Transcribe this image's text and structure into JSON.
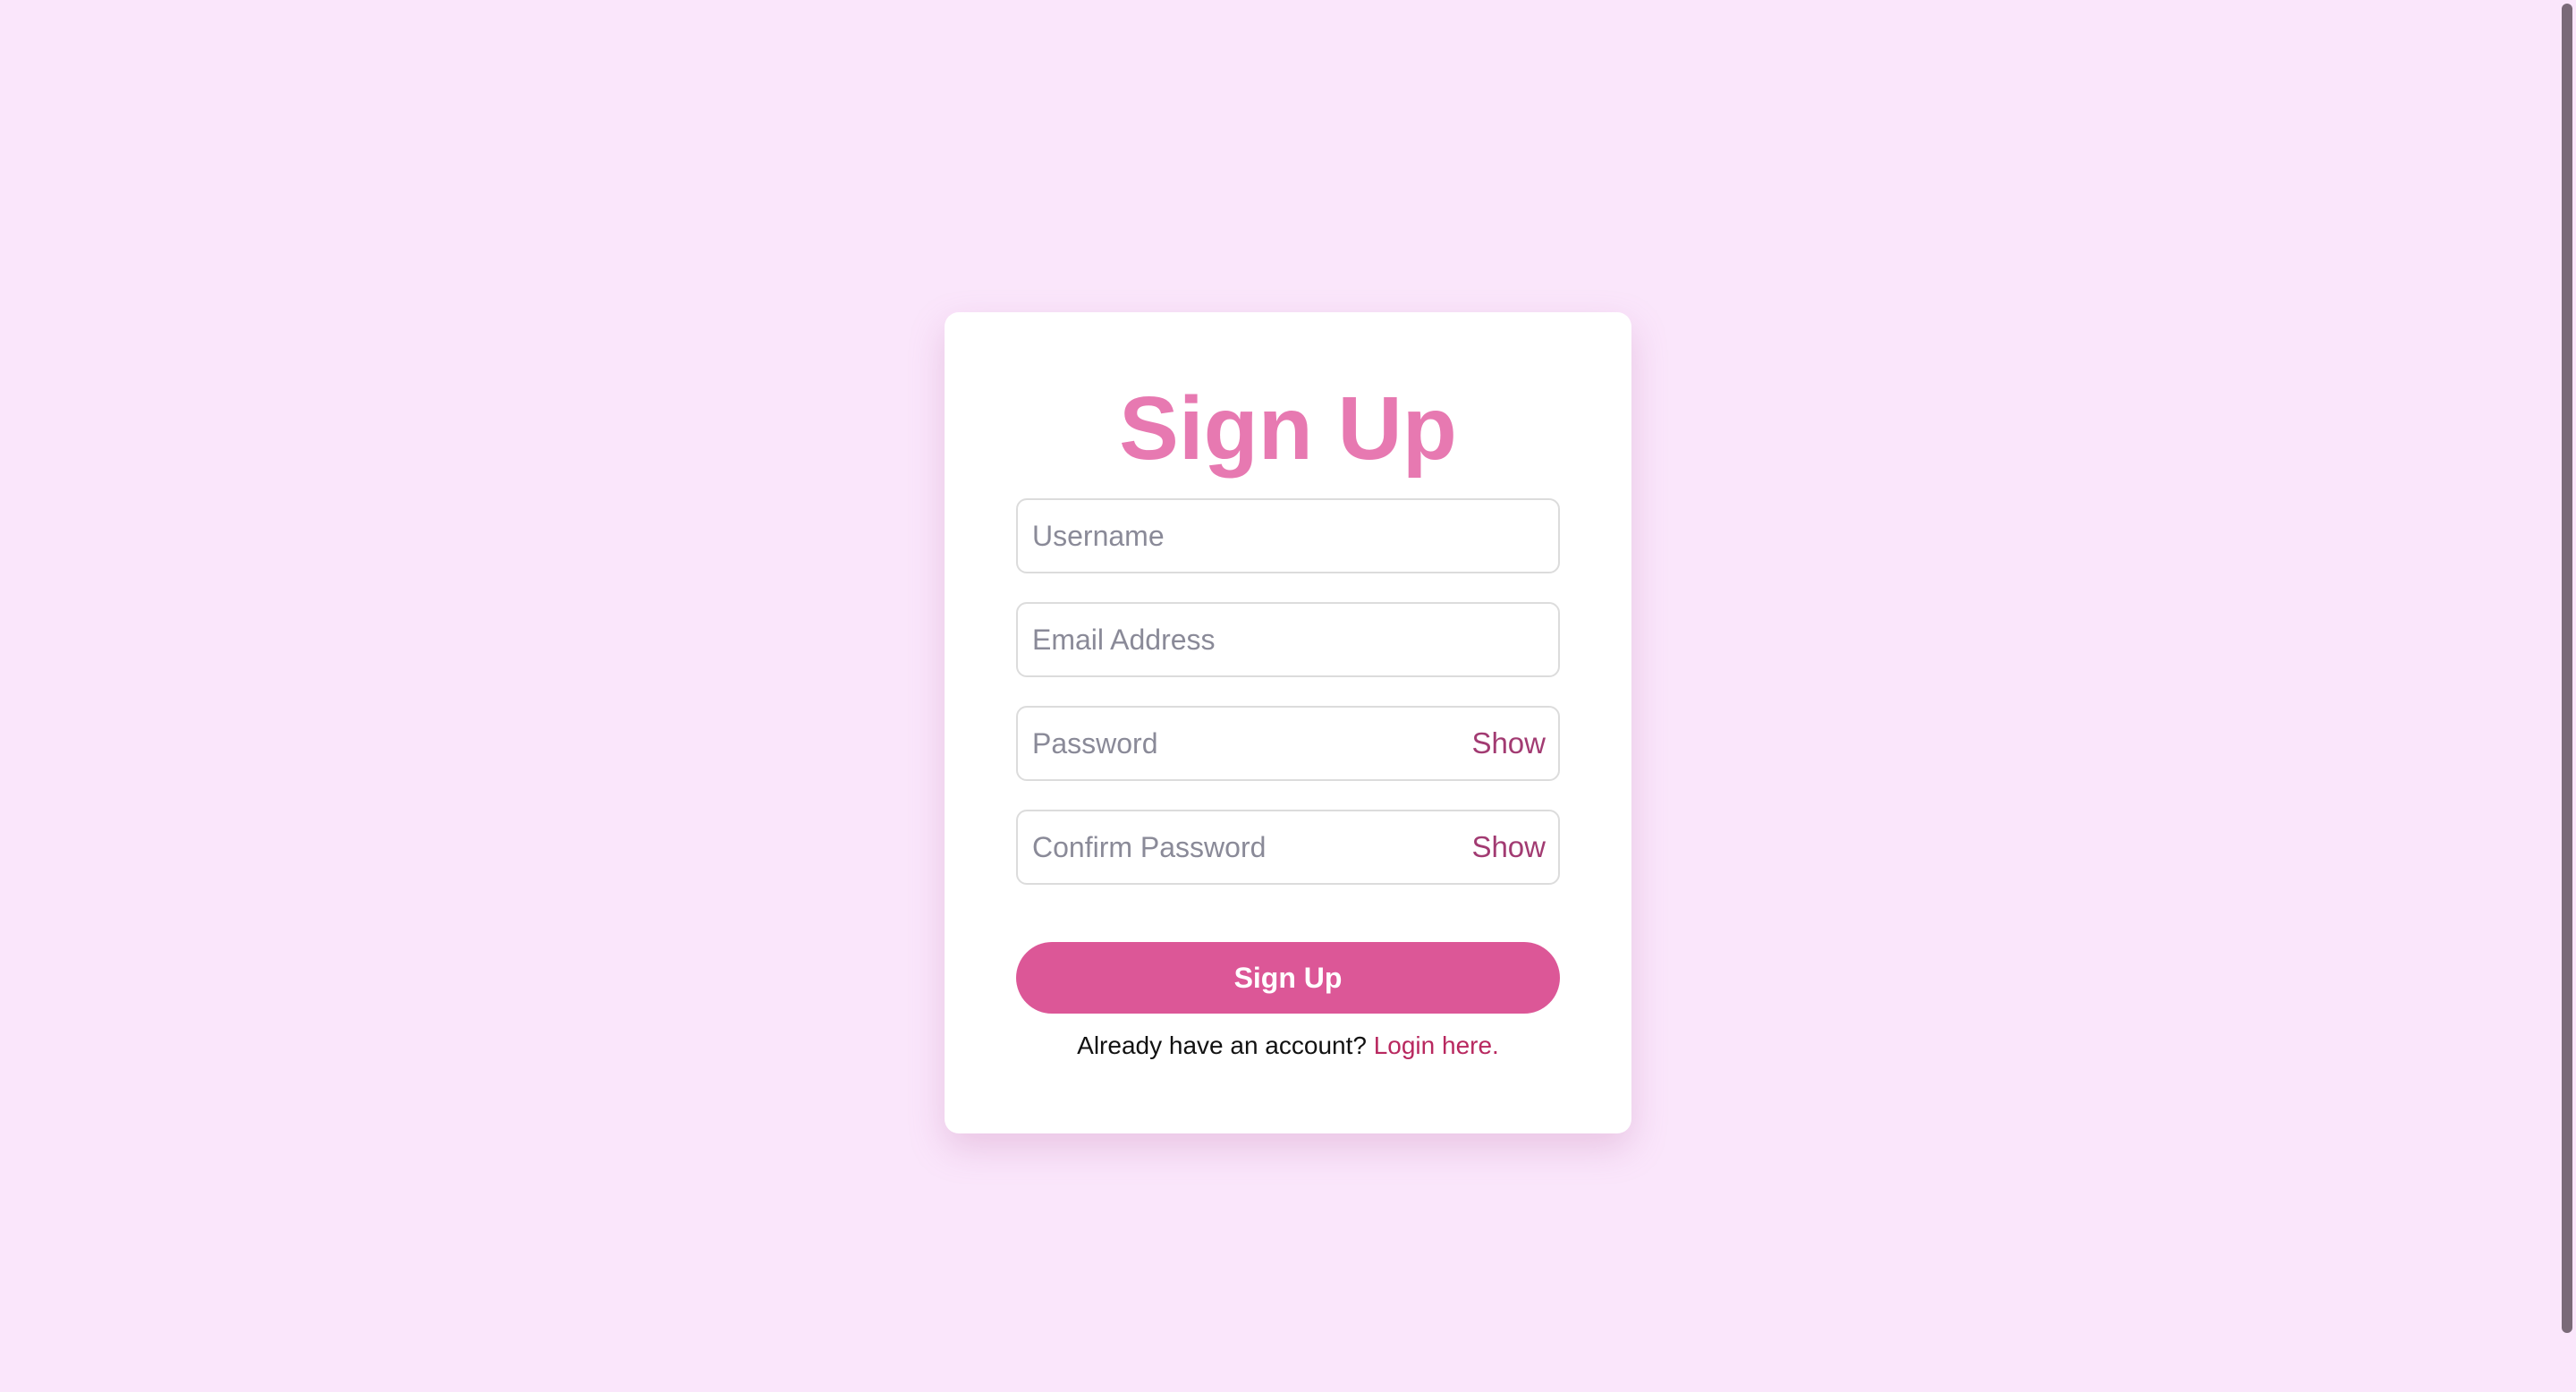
{
  "colors": {
    "background": "#fae6fb",
    "card": "#ffffff",
    "title": "#e779b1",
    "button": "#dc5797",
    "toggle": "#a23b72",
    "link": "#b8285f"
  },
  "form": {
    "title": "Sign Up",
    "fields": [
      {
        "placeholder": "Username",
        "value": ""
      },
      {
        "placeholder": "Email Address",
        "value": ""
      },
      {
        "placeholder": "Password",
        "value": "",
        "toggle_label": "Show"
      },
      {
        "placeholder": "Confirm Password",
        "value": "",
        "toggle_label": "Show"
      }
    ],
    "submit_label": "Sign Up",
    "footer": {
      "prompt": "Already have an account?",
      "link_label": "Login here."
    }
  }
}
